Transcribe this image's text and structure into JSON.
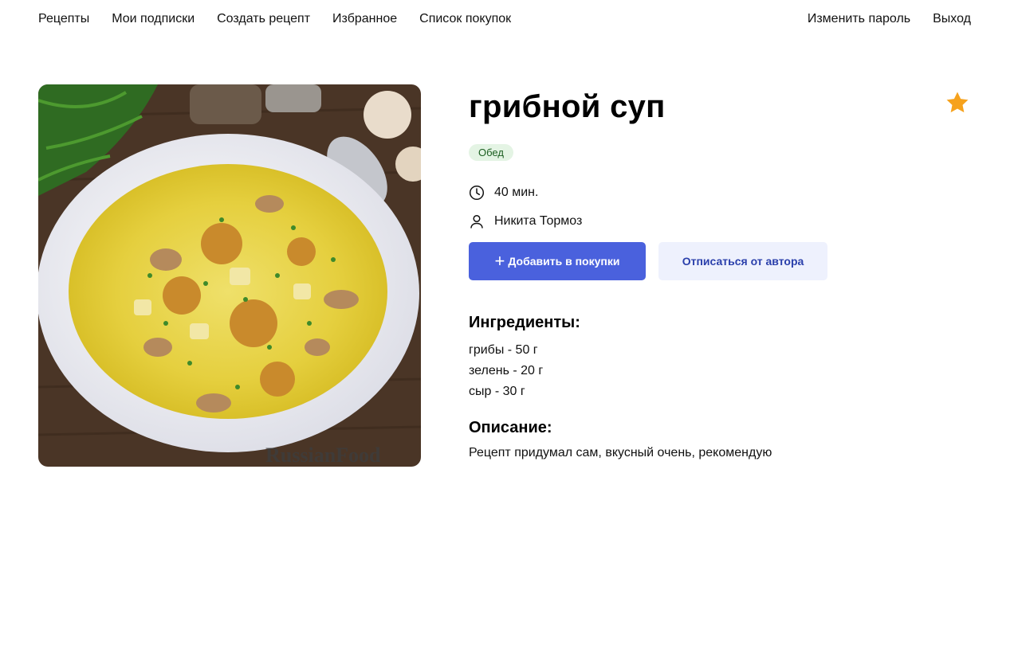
{
  "nav": {
    "left": [
      "Рецепты",
      "Мои подписки",
      "Создать рецепт",
      "Избранное",
      "Список покупок"
    ],
    "right": [
      "Изменить пароль",
      "Выход"
    ]
  },
  "recipe": {
    "title": "грибной суп",
    "tag": "Обед",
    "time": "40 мин.",
    "author": "Никита Тормоз",
    "add_to_cart_label": "Добавить в покупки",
    "unsubscribe_label": "Отписаться от автора",
    "ingredients_heading": "Ингредиенты:",
    "ingredients": [
      "грибы - 50 г",
      "зелень - 20 г",
      "сыр - 30 г"
    ],
    "description_heading": "Описание:",
    "description": "Рецепт придумал сам, вкусный очень, рекомендую",
    "photo_watermark": "RussianFood"
  },
  "colors": {
    "primary": "#4a61dd",
    "secondary_bg": "#eef1fd",
    "star": "#f6a21d",
    "tag_bg": "#e4f4e4",
    "tag_text": "#1b5e20"
  },
  "icons": {
    "favorite": "star-icon",
    "time": "clock-icon",
    "author": "user-icon",
    "add": "plus-icon"
  }
}
